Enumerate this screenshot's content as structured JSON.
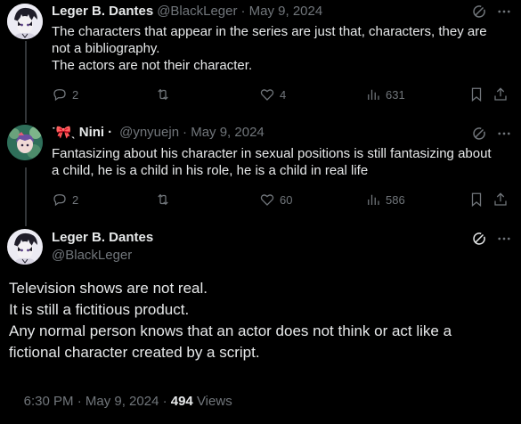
{
  "tweets": [
    {
      "name": "Leger B. Dantes",
      "handle": "@BlackLeger",
      "date": "· May 9, 2024",
      "lines": [
        "The characters that appear in the series are just that, characters, they are",
        "not a bibliography.",
        "The actors are not their character."
      ],
      "replies": "2",
      "reposts": "",
      "likes": "4",
      "views": "631"
    },
    {
      "name_prefix": "˙🎀ˎ",
      "name": "Nini",
      "name_suffix": "·",
      "handle": "@ynyuejn",
      "date": "· May 9, 2024",
      "lines": [
        "Fantasizing about his character in sexual positions is still fantasizing about",
        "a child, he is a child in his role, he is a child in real life"
      ],
      "replies": "2",
      "reposts": "",
      "likes": "60",
      "views": "586"
    }
  ],
  "main": {
    "name": "Leger B. Dantes",
    "handle": "@BlackLeger",
    "lines": [
      "Television shows are not real.",
      "It is still a fictitious product.",
      "Any normal person knows that an actor does not think or act like a",
      "fictional character created by a script."
    ],
    "time": "6:30 PM · May 9, 2024 · ",
    "views_count": "494",
    "views_label": " Views"
  },
  "icons": {
    "grok": "grok-icon",
    "more": "more-icon",
    "reply": "reply-icon",
    "repost": "repost-icon",
    "like": "like-icon",
    "views": "views-icon",
    "bookmark": "bookmark-icon",
    "share": "share-icon"
  },
  "colors": {
    "background": "#000000",
    "text": "#e7e9ea",
    "muted": "#71767b",
    "thread_line": "#333639"
  }
}
